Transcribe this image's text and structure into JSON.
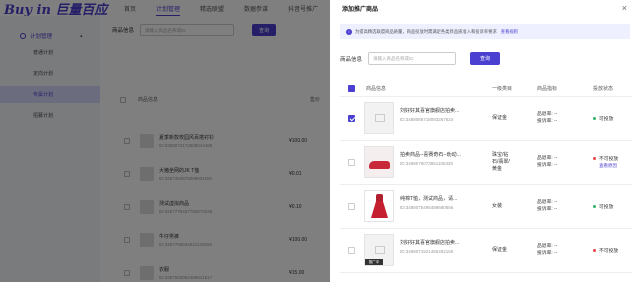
{
  "brand": {
    "logo": "Buy in 巨量百应",
    "accent": "#4a3fd0"
  },
  "topnav": [
    "首页",
    "计划管理",
    "精选联盟",
    "数据参谋",
    "抖音号推广"
  ],
  "sidebar": {
    "group": "计划管理",
    "items": [
      "普通计划",
      "定向计划",
      "专属计划",
      "招募计划"
    ],
    "active_index": 2
  },
  "main": {
    "search_label": "商品信息",
    "search_placeholder": "请输入商品名称或ID",
    "search_button": "查询",
    "col_info": "商品信息",
    "col_price": "售价",
    "rows": [
      {
        "title": "夏季新款校园风百搭衬衫",
        "id": "ID:3488073172608544488",
        "price": "¥100.00"
      },
      {
        "title": "大猪坐网的JK T恤",
        "id": "ID:3487484875009931091",
        "price": "¥0.01"
      },
      {
        "title": "测试虚拟商品",
        "id": "ID:3487775457755879335",
        "price": "¥0.10"
      },
      {
        "title": "牛仔男裤",
        "id": "ID:3487765594831120566",
        "price": "¥100.00"
      },
      {
        "title": "衣服",
        "id": "ID:3487560084488841517",
        "price": "¥15.00"
      }
    ]
  },
  "drawer": {
    "title": "添加推广商品",
    "close": "×",
    "notice": "为提高精选联盟商品质量，商品投放时需满足各类目品质准入和投诉率要求",
    "notice_link": "查看规则",
    "search_label": "商品信息",
    "search_placeholder": "请输入商品名称或ID",
    "search_button": "查询",
    "columns": {
      "info": "商品信息",
      "category": "一级类目",
      "metric": "商品指标",
      "status": "投放状态"
    },
    "rows": [
      {
        "title": "刘好好其喜官旗舰店拍卖...",
        "id": "ID:3488086718083267624",
        "category": [
          "保证金"
        ],
        "metric": [
          "品退率: --",
          "投诉率: --"
        ],
        "status": "可投放",
        "status_type": "ok",
        "thumb": "placeholder",
        "checked": true
      },
      {
        "title": "拍卖商品--喜赛奇石--劝动...",
        "id": "ID:3488076073651105320",
        "category": [
          "珠宝/钻",
          "石/翡翠/",
          "黄金"
        ],
        "metric": [
          "品退率: --",
          "投诉率: --"
        ],
        "status": "不可投放",
        "status_type": "no",
        "reason": "查看原因",
        "thumb": "shoe",
        "checked": false
      },
      {
        "title": "纯棉T恤，测试商品，请...",
        "id": "ID:3488075495489680666",
        "category": [
          "女装"
        ],
        "metric": [
          "品退率: --",
          "投诉率: --"
        ],
        "status": "可投放",
        "status_type": "ok",
        "thumb": "dress",
        "checked": false
      },
      {
        "title": "刘好好其喜官旗舰店拍卖...",
        "id": "ID:3488071521455492165",
        "category": [
          "保证金"
        ],
        "metric": [
          "品退率: --",
          "投诉率: --"
        ],
        "status": "不可投放",
        "status_type": "no",
        "thumb": "placeholder",
        "tag": "推广中",
        "checked": false
      }
    ]
  }
}
